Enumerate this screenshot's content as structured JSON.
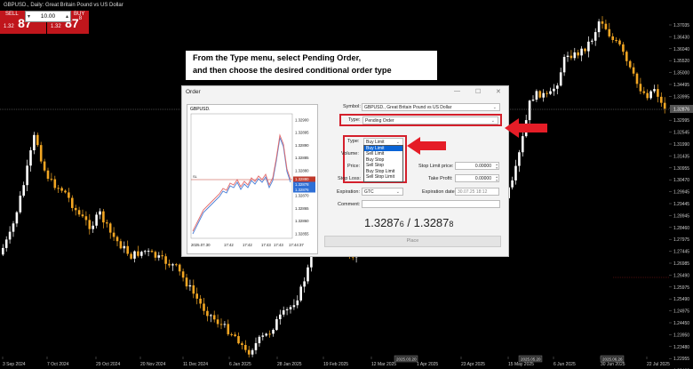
{
  "app": {
    "header": "GBPUSD., Daily: Great Britain Pound vs US Dollar"
  },
  "trade_panel": {
    "sell_label": "SELL",
    "buy_label": "BUY",
    "lot": "10.00",
    "sell_price": {
      "prefix": "1.32",
      "big": "87",
      "sup": "6"
    },
    "buy_price": {
      "prefix": "1.32",
      "big": "87",
      "sup": "8"
    }
  },
  "banner": {
    "line1": "From the Type menu, select Pending Order,",
    "line2": "and then choose the desired conditional order type"
  },
  "dialog": {
    "title": "Order",
    "minimize_glyph": "—",
    "maximize_glyph": "☐",
    "close_glyph": "✕",
    "mini_chart": {
      "symbol": "GBPUSD.",
      "line_marker": "SL",
      "price_labels": [
        "1.32900",
        "1.32895",
        "1.32890",
        "1.32885",
        "1.32880",
        "1.32875",
        "1.32870",
        "1.32865",
        "1.32860",
        "1.32855"
      ],
      "highlight_prices": [
        "1.32880",
        "1.32878",
        "1.32876"
      ],
      "time_labels": [
        "2025.07.30",
        "17:42",
        "17:42",
        "17:43",
        "17:43",
        "17:44:37"
      ]
    },
    "symbol_label": "Symbol:",
    "symbol_value": "GBPUSD., Great Britain Pound vs US Dollar",
    "type_label": "Type:",
    "type_value": "Pending Order",
    "order_type_label": "Type:",
    "order_type_value": "Buy Limit",
    "order_type_options": [
      "Buy Limit",
      "Sell Limit",
      "Buy Stop",
      "Sell Stop",
      "Buy Stop Limit",
      "Sell Stop Limit"
    ],
    "volume_label": "Volume:",
    "price_label": "Price:",
    "stop_loss_label": "Stop Loss:",
    "stop_limit_price_label": "Stop Limit price:",
    "stop_limit_price_value": "0.00000",
    "take_profit_label": "Take Profit:",
    "take_profit_value": "0.00000",
    "expiration_label": "Expiration:",
    "expiration_value": "GTC",
    "expiration_date_label": "Expiration date:",
    "expiration_date_value": "30.07.25 18:12",
    "comment_label": "Comment:",
    "bid_main": "1.3287",
    "bid_small": "6",
    "ask_main": "1.3287",
    "ask_small": "8",
    "separator": " / ",
    "place_label": "Place"
  },
  "axis": {
    "price_labels": [
      "1.37035",
      "1.36430",
      "1.36040",
      "1.35520",
      "1.35000",
      "1.34495",
      "1.33995",
      "1.33505",
      "1.32995",
      "1.32545",
      "1.31990",
      "1.31435",
      "1.30955",
      "1.30470",
      "1.29945",
      "1.29445",
      "1.28945",
      "1.28460",
      "1.27975",
      "1.27445",
      "1.26985",
      "1.26490",
      "1.25975",
      "1.25490",
      "1.24975",
      "1.24450",
      "1.23950",
      "1.23480",
      "1.22955",
      "1.22460"
    ],
    "current_price": "1.32876",
    "date_labels": [
      "3 Sep 2024",
      "7 Oct 2024",
      "29 Oct 2024",
      "20 Nov 2024",
      "11 Dec 2024",
      "6 Jan 2025",
      "28 Jan 2025",
      "19 Feb 2025",
      "12 Mar 2025",
      "1 Apr 2025",
      "23 Apr 2025",
      "15 May 2025",
      "6 Jun 2025",
      "30 Jun 2025",
      "22 Jul 2025"
    ],
    "date_tags": [
      "2025.03.20",
      "2025.05.20",
      "2025.06.26"
    ]
  },
  "colors": {
    "background": "#000000",
    "bull_candle": "#ffffff",
    "bear_candle": "#f2a623",
    "sell_bg": "#c0161c",
    "highlight": "#d41f2b",
    "selection": "#0a64d6"
  }
}
